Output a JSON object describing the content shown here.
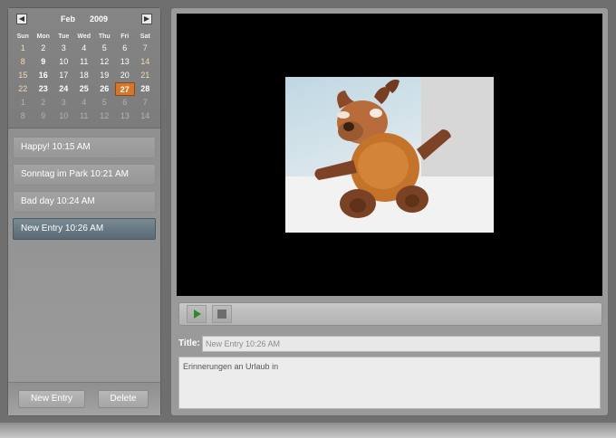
{
  "calendar": {
    "prev_icon": "◀",
    "next_icon": "▶",
    "month": "Feb",
    "year": "2009",
    "weekdays": [
      "Sun",
      "Mon",
      "Tue",
      "Wed",
      "Thu",
      "Fri",
      "Sat"
    ],
    "weeks": [
      [
        "1",
        "2",
        "3",
        "4",
        "5",
        "6",
        "7"
      ],
      [
        "8",
        "9",
        "10",
        "11",
        "12",
        "13",
        "14"
      ],
      [
        "15",
        "16",
        "17",
        "18",
        "19",
        "20",
        "21"
      ],
      [
        "22",
        "23",
        "24",
        "25",
        "26",
        "27",
        "28"
      ],
      [
        "1",
        "2",
        "3",
        "4",
        "5",
        "6",
        "7"
      ],
      [
        "8",
        "9",
        "10",
        "11",
        "12",
        "13",
        "14"
      ]
    ],
    "selected_day": "27"
  },
  "entries": [
    {
      "label": "Happy! 10:15 AM"
    },
    {
      "label": "Sonntag im Park 10:21 AM"
    },
    {
      "label": "Bad day 10:24 AM"
    },
    {
      "label": "New Entry 10:26 AM"
    }
  ],
  "buttons": {
    "new_entry": "New Entry",
    "delete": "Delete"
  },
  "player": {
    "play_icon": "play-icon",
    "stop_icon": "stop-icon",
    "photo": "plush-moose-toy"
  },
  "form": {
    "title_label": "Title:",
    "title_value": "New Entry 10:26 AM",
    "notes": "Erinnerungen an Urlaub in"
  },
  "colors": {
    "selected_day": "#d4772d",
    "selected_entry": "#6a7a84",
    "play_icon": "#2f8a2a"
  }
}
